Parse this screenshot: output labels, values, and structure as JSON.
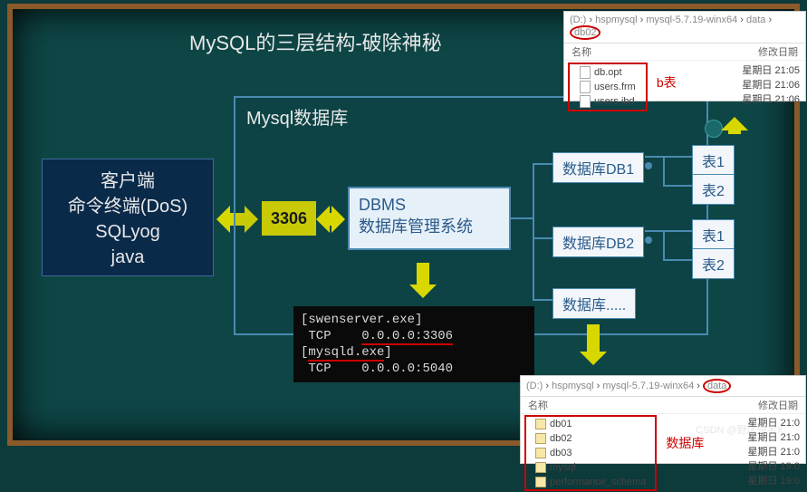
{
  "title": "MySQL的三层结构-破除神秘",
  "client": {
    "l1": "客户端",
    "l2": "命令终端(DoS)",
    "l3": "SQLyog",
    "l4": "java"
  },
  "port": "3306",
  "container_title": "Mysql数据库",
  "dbms": {
    "l1": "DBMS",
    "l2": "数据库管理系统"
  },
  "nodes": {
    "db1": "数据库DB1",
    "db2": "数据库DB2",
    "db3": "数据库.....",
    "t1": "表1",
    "t2": "表2"
  },
  "terminal": {
    "l1": "[swenserver.exe]",
    "l2a": "TCP",
    "l2b": "0.0.0.0:3306",
    "l3": "[mysqld.exe]",
    "l4a": "TCP",
    "l4b": "0.0.0.0:5040"
  },
  "explorer_top": {
    "crumbs": [
      "(D:)",
      "hspmysql",
      "mysql-5.7.19-winx64",
      "data",
      "db02"
    ],
    "hdr_name": "名称",
    "hdr_date": "修改日期",
    "files": [
      "db.opt",
      "users.frm",
      "users.ibd"
    ],
    "dates": [
      "星期日 21:05",
      "星期日 21:06",
      "星期日 21:06"
    ],
    "note": "b表"
  },
  "explorer_bot": {
    "crumbs": [
      "(D:)",
      "hspmysql",
      "mysql-5.7.19-winx64",
      "data"
    ],
    "hdr_name": "名称",
    "hdr_date": "修改日期",
    "folders": [
      "db01",
      "db02",
      "db03",
      "mysql",
      "performance_schema"
    ],
    "dates": [
      "星期日 21:0",
      "星期日 21:0",
      "星期日 21:0",
      "星期日 19:0",
      "星期日 19:0"
    ],
    "note": "数据库"
  },
  "watermark": "CSDN @野区杀手X"
}
